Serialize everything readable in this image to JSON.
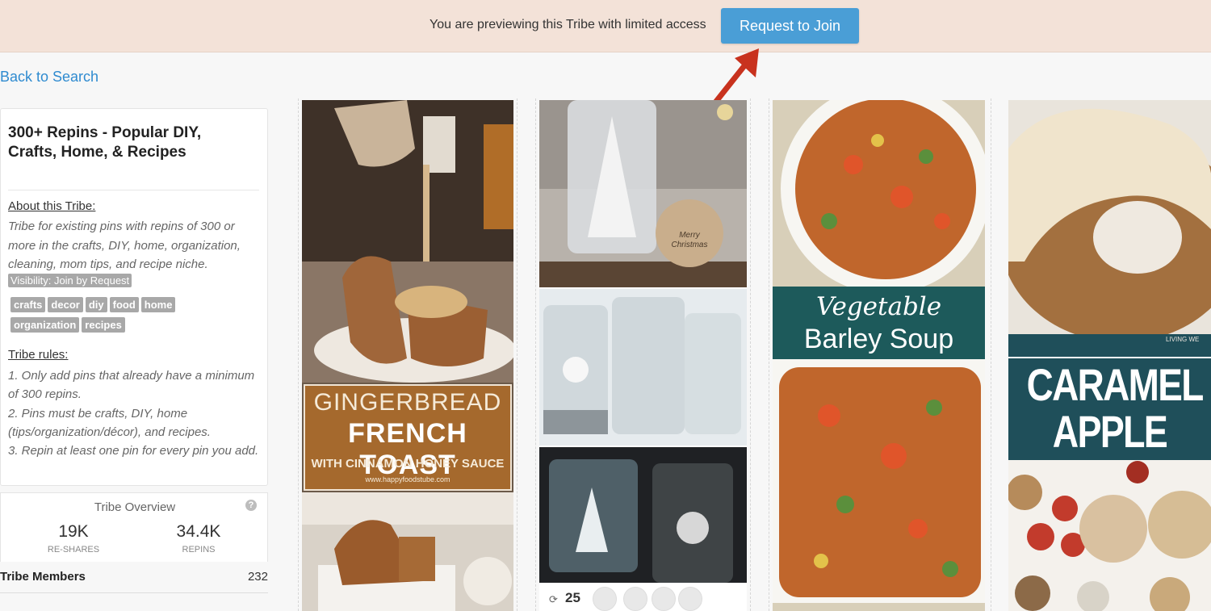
{
  "banner": {
    "text": "You are previewing this Tribe with limited access",
    "join_label": "Request to Join"
  },
  "nav": {
    "back_label": "Back to Search"
  },
  "tribe": {
    "title": "300+ Repins - Popular DIY, Crafts, Home, & Recipes",
    "about_title": "About this Tribe:",
    "about_text": "Tribe for existing pins with repins of 300 or more in the crafts, DIY, home, organization, cleaning, mom tips, and recipe niche.",
    "visibility": "Visibility: Join by Request",
    "tags": [
      "crafts",
      "decor",
      "diy",
      "food",
      "home",
      "organization",
      "recipes"
    ],
    "rules_title": "Tribe rules:",
    "rules": [
      "1. Only add pins that already have a minimum of 300 repins.",
      "2. Pins must be crafts, DIY, home (tips/organization/décor), and recipes.",
      "3. Repin at least one pin for every pin you add."
    ]
  },
  "overview": {
    "title": "Tribe Overview",
    "help_glyph": "?",
    "reshares_value": "19K",
    "reshares_label": "RE-SHARES",
    "repins_value": "34.4K",
    "repins_label": "REPINS",
    "members_label": "Tribe Members",
    "members_count": "232"
  },
  "pins": {
    "gingerbread": {
      "line1": "GINGERBREAD",
      "line2": "FRENCH TOAST",
      "line3": "WITH CINNAMON HONEY SAUCE",
      "url": "www.happyfoodstube.com"
    },
    "snowglobe": {
      "tag_text": "Merry Christmas",
      "repin_icon": "⟳",
      "repin_count": "25"
    },
    "soup": {
      "line1": "Vegetable",
      "line2": "Barley Soup"
    },
    "cake": {
      "line1": "CARAMEL",
      "line2": "APPLE CAKE",
      "watermark": "LIVING WE"
    }
  },
  "colors": {
    "banner_bg": "#f3e2d8",
    "button": "#4a9ed6",
    "link": "#2f8bd0",
    "arrow": "#c8321e",
    "tag_bg": "#a8a8a8",
    "soup_band": "#1d5a5b",
    "cake_band": "#1f4f5a",
    "ginger_band": "#a5692d"
  }
}
